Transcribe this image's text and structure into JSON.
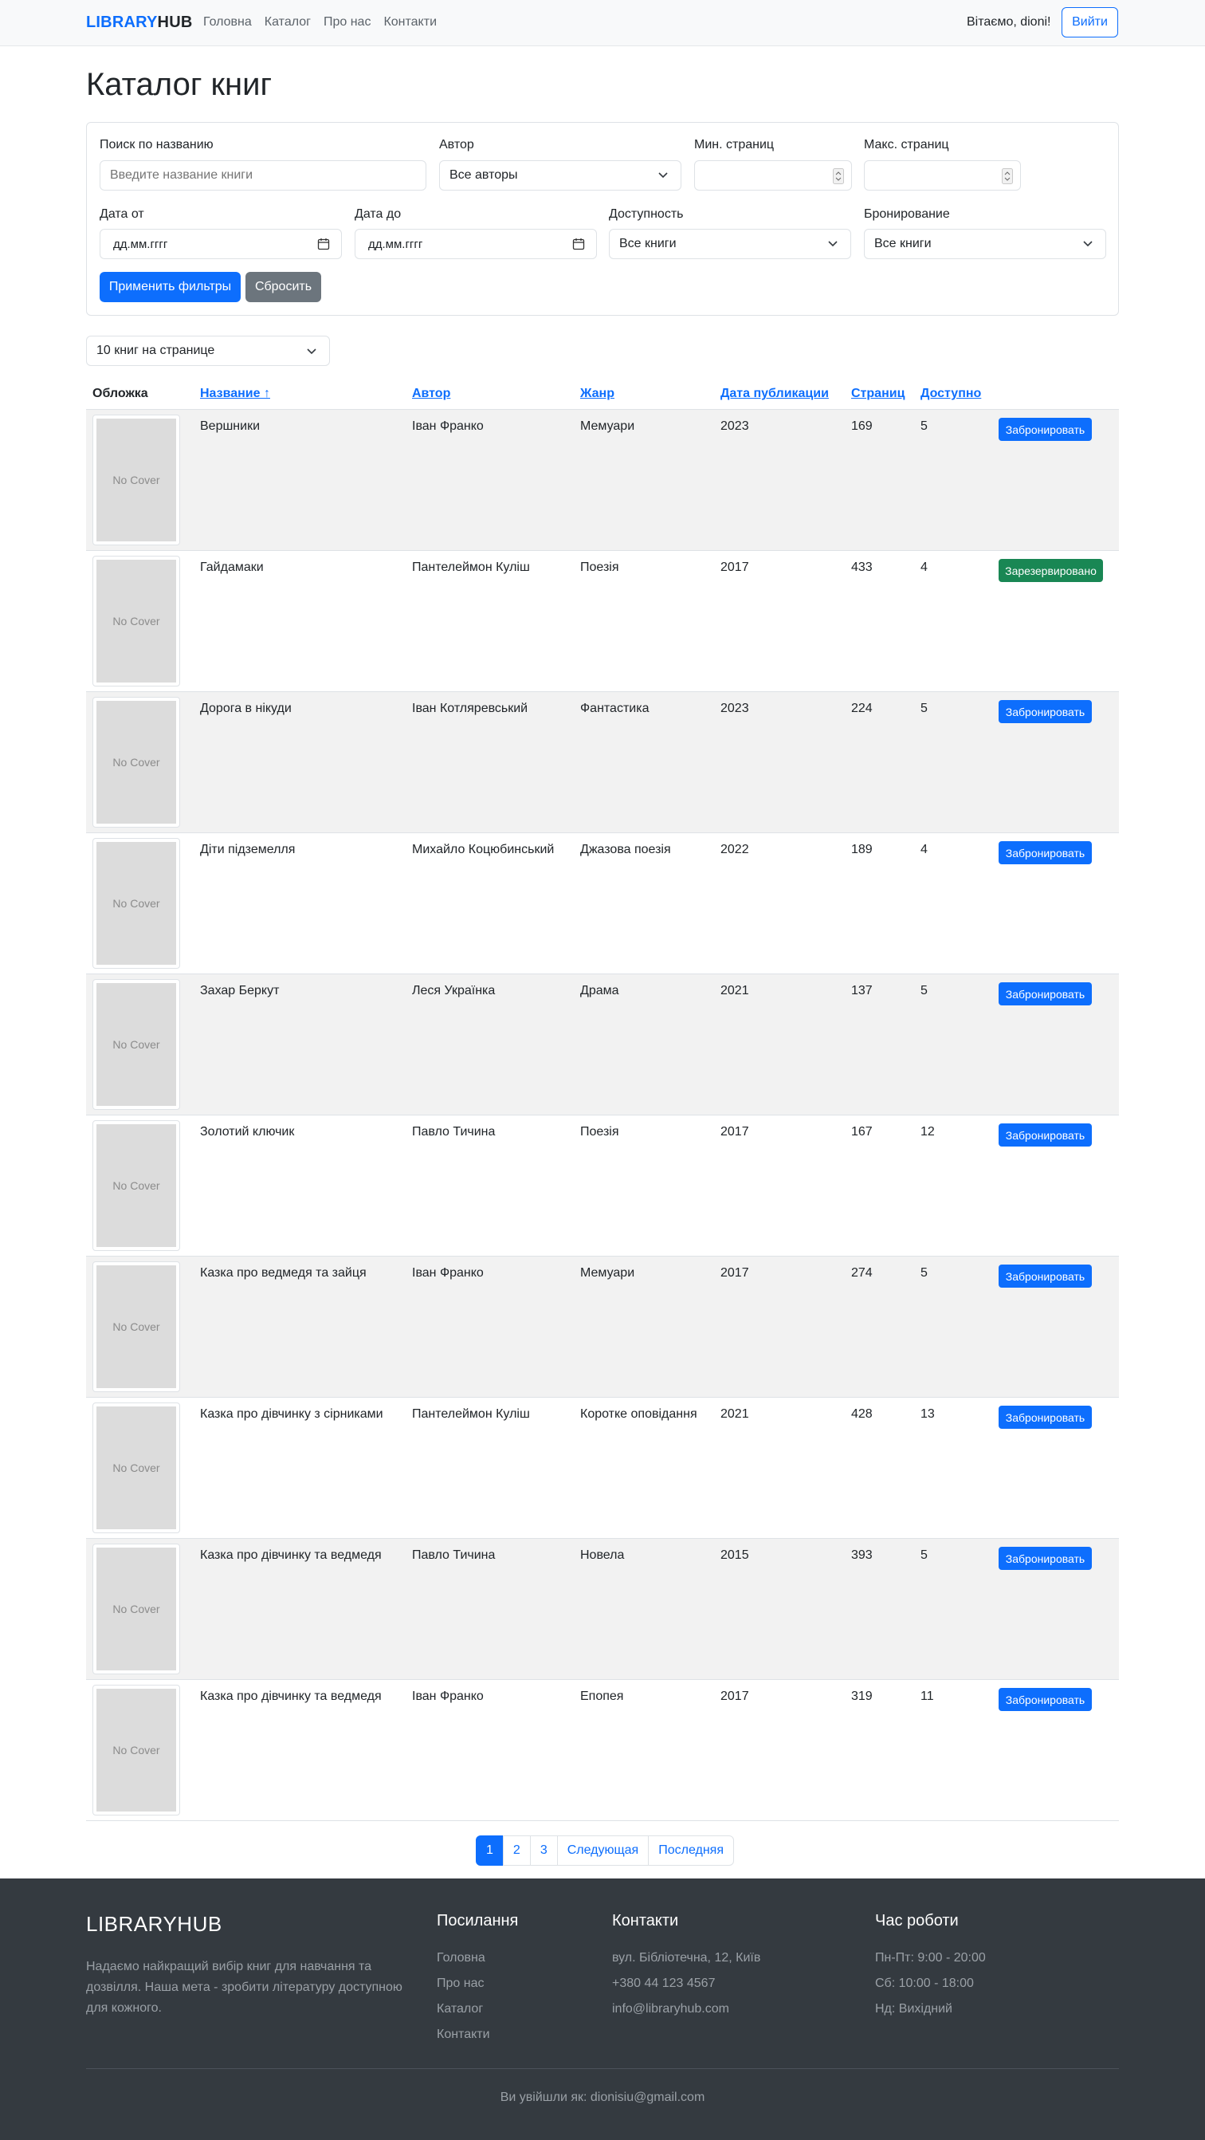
{
  "navbar": {
    "brand_part1": "LIBRARY",
    "brand_part2": "HUB",
    "links": [
      "Головна",
      "Каталог",
      "Про нас",
      "Контакти"
    ],
    "greeting": "Вітаємо, dioni!",
    "logout": "Вийти"
  },
  "page": {
    "title": "Каталог книг"
  },
  "filters": {
    "title_label": "Поиск по названию",
    "title_placeholder": "Введите название книги",
    "author_label": "Автор",
    "author_value": "Все авторы",
    "min_pages_label": "Мин. страниц",
    "max_pages_label": "Макс. страниц",
    "date_from_label": "Дата от",
    "date_from_value": "дд.мм.гггг",
    "date_to_label": "Дата до",
    "date_to_value": "дд.мм.гггг",
    "availability_label": "Доступность",
    "availability_value": "Все книги",
    "booking_label": "Бронирование",
    "booking_value": "Все книги",
    "apply": "Применить фильтры",
    "reset": "Сбросить"
  },
  "per_page": "10 книг на странице",
  "table": {
    "headers": {
      "cover": "Обложка",
      "title": "Название ↑",
      "author": "Автор",
      "genre": "Жанр",
      "date": "Дата публикации",
      "pages": "Страниц",
      "available": "Доступно"
    },
    "no_cover": "No Cover",
    "rows": [
      {
        "title": "Вершники",
        "author": "Іван Франко",
        "genre": "Мемуари",
        "year": "2023",
        "pages": "169",
        "available": "5",
        "action": "Забронировать",
        "status": "book"
      },
      {
        "title": "Гайдамаки",
        "author": "Пантелеймон Куліш",
        "genre": "Поезія",
        "year": "2017",
        "pages": "433",
        "available": "4",
        "action": "Зарезервировано",
        "status": "reserved"
      },
      {
        "title": "Дорога в нікуди",
        "author": "Іван Котляревський",
        "genre": "Фантастика",
        "year": "2023",
        "pages": "224",
        "available": "5",
        "action": "Забронировать",
        "status": "book"
      },
      {
        "title": "Діти підземелля",
        "author": "Михайло Коцюбинський",
        "genre": "Джазова поезія",
        "year": "2022",
        "pages": "189",
        "available": "4",
        "action": "Забронировать",
        "status": "book"
      },
      {
        "title": "Захар Беркут",
        "author": "Леся Українка",
        "genre": "Драма",
        "year": "2021",
        "pages": "137",
        "available": "5",
        "action": "Забронировать",
        "status": "book"
      },
      {
        "title": "Золотий ключик",
        "author": "Павло Тичина",
        "genre": "Поезія",
        "year": "2017",
        "pages": "167",
        "available": "12",
        "action": "Забронировать",
        "status": "book"
      },
      {
        "title": "Казка про ведмедя та зайця",
        "author": "Іван Франко",
        "genre": "Мемуари",
        "year": "2017",
        "pages": "274",
        "available": "5",
        "action": "Забронировать",
        "status": "book"
      },
      {
        "title": "Казка про дівчинку з сірниками",
        "author": "Пантелеймон Куліш",
        "genre": "Коротке оповідання",
        "year": "2021",
        "pages": "428",
        "available": "13",
        "action": "Забронировать",
        "status": "book"
      },
      {
        "title": "Казка про дівчинку та ведмедя",
        "author": "Павло Тичина",
        "genre": "Новела",
        "year": "2015",
        "pages": "393",
        "available": "5",
        "action": "Забронировать",
        "status": "book"
      },
      {
        "title": "Казка про дівчинку та ведмедя",
        "author": "Іван Франко",
        "genre": "Епопея",
        "year": "2017",
        "pages": "319",
        "available": "11",
        "action": "Забронировать",
        "status": "book"
      }
    ]
  },
  "pagination": {
    "pages": [
      "1",
      "2",
      "3"
    ],
    "active": "1",
    "next": "Следующая",
    "last": "Последняя"
  },
  "footer": {
    "brand": "LIBRARYHUB",
    "description": "Надаємо найкращий вибір книг для навчання та дозвілля. Наша мета - зробити літературу доступною для кожного.",
    "links_title": "Посилання",
    "links": [
      "Головна",
      "Про нас",
      "Каталог",
      "Контакти"
    ],
    "contacts_title": "Контакти",
    "contacts": [
      "вул. Бібліотечна, 12, Київ",
      "+380 44 123 4567",
      "info@libraryhub.com"
    ],
    "hours_title": "Час роботи",
    "hours": [
      "Пн-Пт: 9:00 - 20:00",
      "Сб: 10:00 - 18:00",
      "Нд: Вихідний"
    ],
    "logged_in_as": "Ви увійшли як: dionisiu@gmail.com"
  },
  "colors": {
    "primary": "#0d6efd",
    "success": "#198754",
    "secondary": "#6c757d",
    "footer_bg": "#343a40"
  }
}
